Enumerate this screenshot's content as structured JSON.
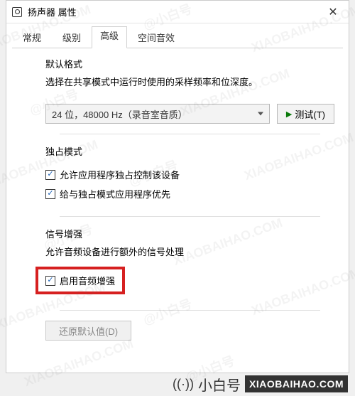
{
  "window": {
    "title": "扬声器 属性"
  },
  "tabs": {
    "items": [
      {
        "label": "常规"
      },
      {
        "label": "级别"
      },
      {
        "label": "高级"
      },
      {
        "label": "空间音效"
      }
    ],
    "active_index": 2
  },
  "default_format": {
    "title": "默认格式",
    "desc": "选择在共享模式中运行时使用的采样频率和位深度。",
    "selected": "24 位，48000 Hz（录音室音质）",
    "test_button": "测试(T)"
  },
  "exclusive": {
    "title": "独占模式",
    "opt1": "允许应用程序独占控制该设备",
    "opt2": "给与独占模式应用程序优先"
  },
  "enhance": {
    "title": "信号增强",
    "desc": "允许音频设备进行额外的信号处理",
    "opt": "启用音频增强"
  },
  "restore": "还原默认值(D)",
  "branding": {
    "name": "小白号",
    "domain": "XIAOBAIHAO.COM",
    "wm_cn": "@小白号",
    "wm_en": "XIAOBAIHAO.COM"
  }
}
